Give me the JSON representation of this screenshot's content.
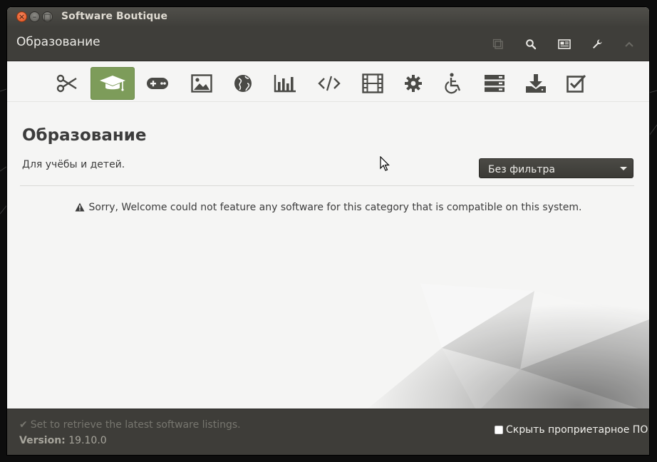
{
  "window": {
    "title": "Software Boutique"
  },
  "header": {
    "title": "Образование"
  },
  "header_buttons": [
    {
      "name": "copy-icon"
    },
    {
      "name": "search-icon"
    },
    {
      "name": "news-icon"
    },
    {
      "name": "wrench-icon"
    },
    {
      "name": "chevron-up-icon"
    }
  ],
  "categories": [
    {
      "icon": "scissors-icon"
    },
    {
      "icon": "graduation-cap-icon",
      "active": true
    },
    {
      "icon": "gamepad-icon"
    },
    {
      "icon": "image-icon"
    },
    {
      "icon": "globe-icon"
    },
    {
      "icon": "bar-chart-icon"
    },
    {
      "icon": "code-icon"
    },
    {
      "icon": "film-icon"
    },
    {
      "icon": "gear-icon"
    },
    {
      "icon": "wheelchair-icon"
    },
    {
      "icon": "server-icon"
    },
    {
      "icon": "download-icon"
    },
    {
      "icon": "checkbox-icon"
    }
  ],
  "page": {
    "heading": "Образование",
    "subtitle": "Для учёбы и детей.",
    "filter_value": "Без фильтра",
    "notice": "Sorry, Welcome could not feature any software for this category that is compatible on this system."
  },
  "footer": {
    "status": "Set to retrieve the latest software listings.",
    "version_label": "Version:",
    "version_value": "19.10.0",
    "hide_proprietary": "Скрыть проприетарное ПО"
  },
  "colors": {
    "accent": "#7d9c5a",
    "header_bg": "#3f3e3a",
    "icon": "#4a4a46"
  }
}
